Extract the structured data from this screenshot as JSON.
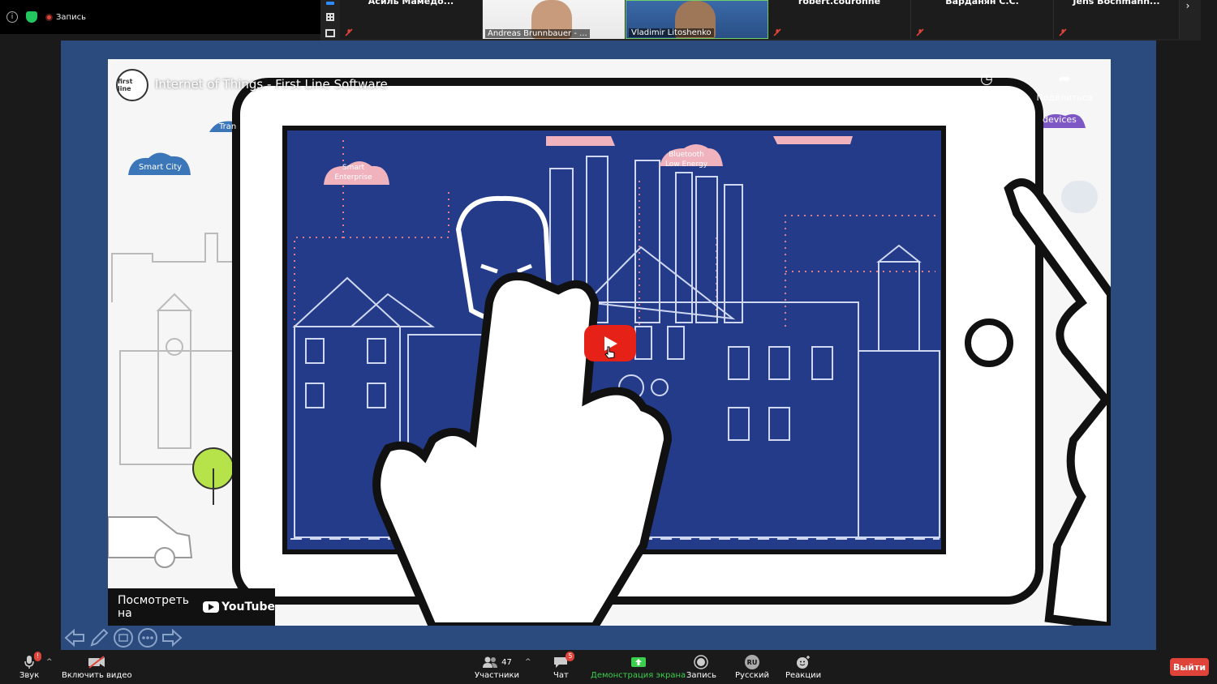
{
  "meeting": {
    "recording_label": "Запись"
  },
  "participants": {
    "names": [
      "Асиль Мамедо...",
      "Andreas Brunnbauer - ...",
      "Vladimir Litoshenko",
      "robert.couronne",
      "Варданян С.С.",
      "Jens Bochmann..."
    ]
  },
  "video": {
    "title": "Internet of Things - First Line Software",
    "channel_logo_text": "first line",
    "watch_later_label": "Смотреть ...",
    "share_label": "Поделиться",
    "watch_on_label": "Посмотреть на",
    "youtube_brand": "YouTube",
    "art_labels": {
      "smart_city": "Smart City",
      "smart_enterprise": "Smart Enterprise",
      "bluetooth": "Bluetooth Low Energy",
      "devices": "devices",
      "tran": "Tran"
    }
  },
  "toolbar": {
    "audio": "Звук",
    "audio_badge": "!",
    "video": "Включить видео",
    "participants": "Участники",
    "participants_count": "47",
    "chat": "Чат",
    "chat_badge": "5",
    "share_screen": "Демонстрация экрана",
    "record": "Запись",
    "language": "Русский",
    "language_code": "RU",
    "reactions": "Реакции",
    "leave": "Выйти"
  },
  "colors": {
    "stage": "#2b4a7e",
    "accent_green": "#3ccf4e",
    "danger": "#e0433a",
    "youtube_red": "#e62117"
  }
}
